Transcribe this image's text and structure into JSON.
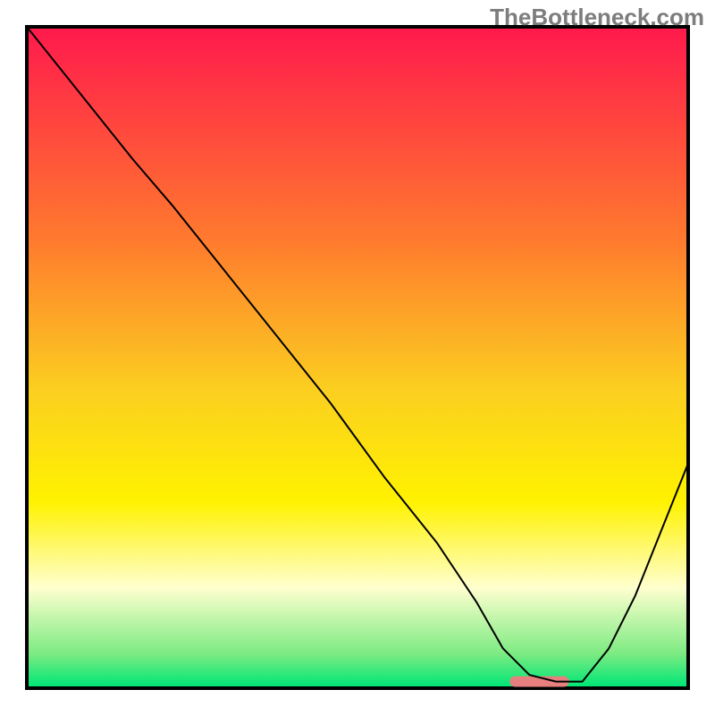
{
  "watermark": "TheBottleneck.com",
  "chart_data": {
    "type": "line",
    "title": "",
    "xlabel": "",
    "ylabel": "",
    "xlim": [
      0,
      100
    ],
    "ylim": [
      0,
      100
    ],
    "grid": false,
    "background_gradient": {
      "stops": [
        {
          "pos": 0.0,
          "color": "#ff1a4c"
        },
        {
          "pos": 0.32,
          "color": "#ff7a2e"
        },
        {
          "pos": 0.55,
          "color": "#fbcf20"
        },
        {
          "pos": 0.72,
          "color": "#fff200"
        },
        {
          "pos": 0.85,
          "color": "#ffffcf"
        },
        {
          "pos": 0.95,
          "color": "#7deb82"
        },
        {
          "pos": 1.0,
          "color": "#00e676"
        }
      ]
    },
    "series": [
      {
        "name": "curve",
        "color": "#000000",
        "stroke_width": 2,
        "x": [
          0,
          8,
          16,
          22,
          30,
          38,
          46,
          54,
          62,
          68,
          72,
          76,
          80,
          84,
          88,
          92,
          96,
          100
        ],
        "y": [
          100,
          90,
          80,
          73,
          63,
          53,
          43,
          32,
          22,
          13,
          6,
          2,
          1,
          1,
          6,
          14,
          24,
          34
        ]
      }
    ],
    "marker": {
      "x_range": [
        73,
        82
      ],
      "y": 1,
      "color": "#e77f7f",
      "height": 1.6
    }
  }
}
